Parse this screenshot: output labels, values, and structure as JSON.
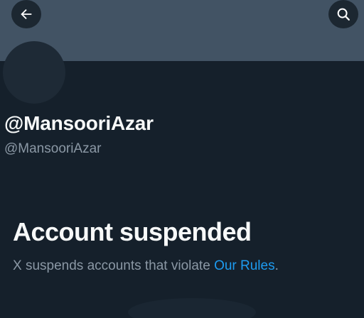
{
  "header": {
    "back_icon": "arrow-left-icon",
    "search_icon": "search-icon"
  },
  "profile": {
    "display_name": "@MansooriAzar",
    "handle": "@MansooriAzar"
  },
  "suspension": {
    "title": "Account suspended",
    "description_prefix": "X suspends accounts that violate ",
    "link_text": "Our Rules",
    "description_suffix": "."
  },
  "colors": {
    "background": "#15202b",
    "banner": "#425364",
    "primary_text": "#f7f9f9",
    "secondary_text": "#8b98a5",
    "link": "#1d9bf0"
  }
}
